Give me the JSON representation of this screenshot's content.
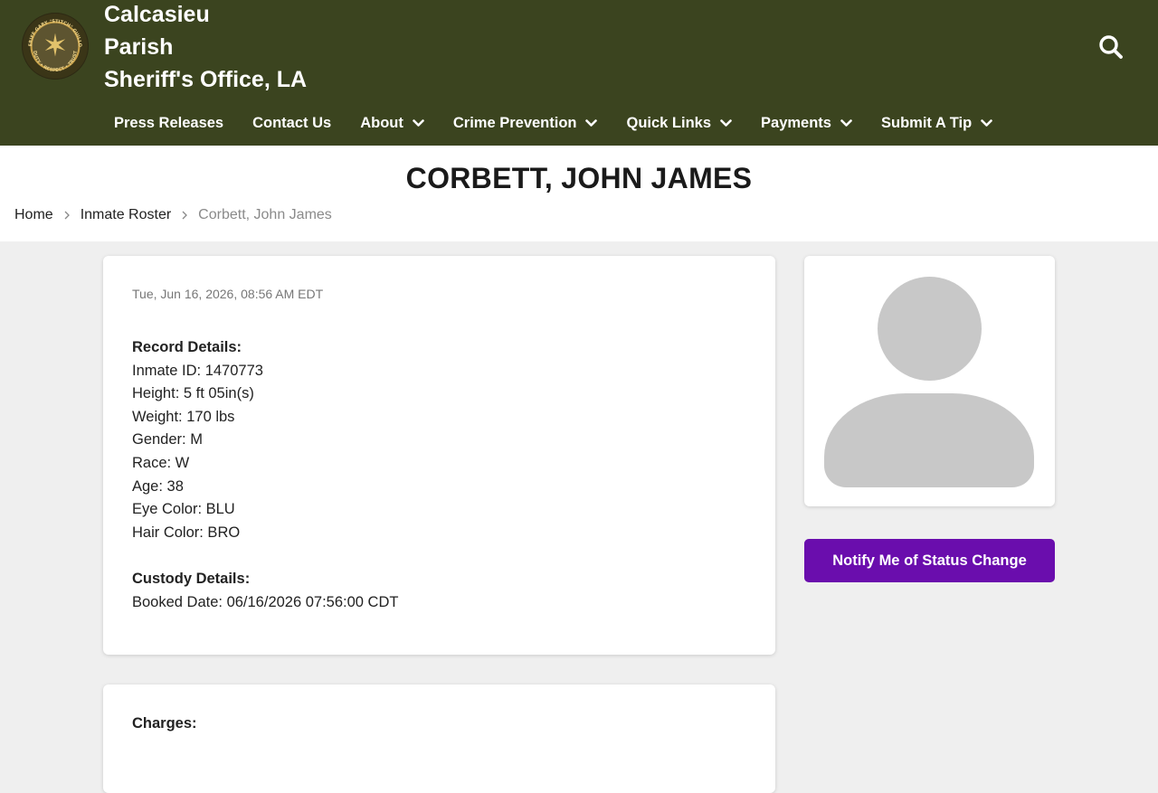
{
  "colors": {
    "brand": "#3b441f",
    "accent": "#6a0dad"
  },
  "header": {
    "title_line1": "Calcasieu",
    "title_line2": "Parish",
    "title_line3": "Sheriff's Office, LA"
  },
  "logo": {
    "ring_text_top": "SHERIFF GARY \"STITCH\" GUILLORY",
    "ring_text_bottom": "DUTY • RESPECT • TRUST"
  },
  "nav": {
    "items": [
      {
        "label": "Press Releases",
        "dropdown": false
      },
      {
        "label": "Contact Us",
        "dropdown": false
      },
      {
        "label": "About",
        "dropdown": true
      },
      {
        "label": "Crime Prevention",
        "dropdown": true
      },
      {
        "label": "Quick Links",
        "dropdown": true
      },
      {
        "label": "Payments",
        "dropdown": true
      },
      {
        "label": "Submit A Tip",
        "dropdown": true
      }
    ]
  },
  "page": {
    "title": "CORBETT, JOHN JAMES"
  },
  "breadcrumb": {
    "home": "Home",
    "roster": "Inmate Roster",
    "current": "Corbett, John James"
  },
  "record": {
    "timestamp": "Tue, Jun 16, 2026, 08:56 AM EDT",
    "record_heading": "Record Details:",
    "inmate_id": "Inmate ID: 1470773",
    "height": "Height: 5 ft 05in(s)",
    "weight": "Weight: 170 lbs",
    "gender": "Gender: M",
    "race": "Race: W",
    "age": "Age: 38",
    "eye_color": "Eye Color: BLU",
    "hair_color": "Hair Color: BRO",
    "custody_heading": "Custody Details:",
    "booked_date": "Booked Date: 06/16/2026 07:56:00 CDT"
  },
  "charges": {
    "heading": "Charges:"
  },
  "actions": {
    "notify_label": "Notify Me of Status Change"
  }
}
